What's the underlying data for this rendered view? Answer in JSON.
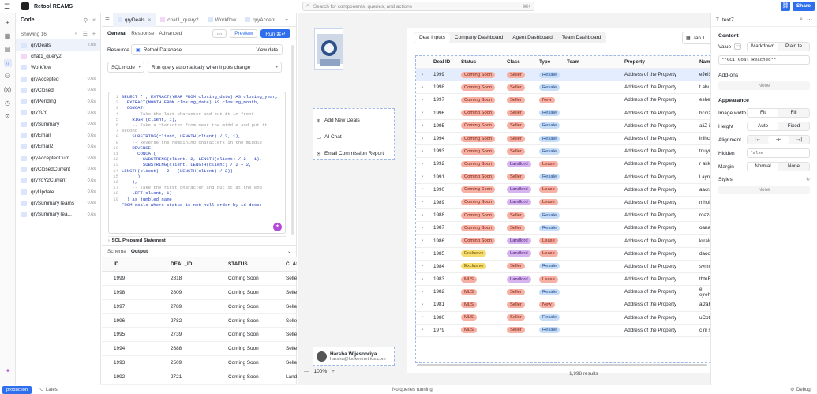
{
  "app": {
    "title": "Retool REAMS",
    "search_placeholder": "Search for components, queries, and actions",
    "search_shortcut": "⌘K",
    "share_label": "Share"
  },
  "code_panel": {
    "title": "Code",
    "showing": "Showing 16",
    "items": [
      {
        "name": "qryDeals",
        "time": "2.0s",
        "selected": true
      },
      {
        "name": "chat1_query2",
        "time": ""
      },
      {
        "name": "Workflow",
        "time": ""
      },
      {
        "name": "qryAccepted",
        "time": "0.6s"
      },
      {
        "name": "qryClosed",
        "time": "0.6s"
      },
      {
        "name": "qryPending",
        "time": "0.6s"
      },
      {
        "name": "qryYoY",
        "time": "0.6s"
      },
      {
        "name": "qrySummary",
        "time": "0.6s"
      },
      {
        "name": "qryEmail",
        "time": "0.6s"
      },
      {
        "name": "qryEmail2",
        "time": "0.6s"
      },
      {
        "name": "qryAcceptedCurr...",
        "time": "0.6s"
      },
      {
        "name": "qryClosedCurrent",
        "time": "0.6s"
      },
      {
        "name": "qryYoY2Current",
        "time": "0.6s"
      },
      {
        "name": "qryUpdate",
        "time": "0.6s"
      },
      {
        "name": "qrySummaryTeams",
        "time": "0.6s"
      },
      {
        "name": "qrySummaryTea...",
        "time": "0.6s"
      }
    ]
  },
  "editor": {
    "tabs": [
      "qryDeals",
      "chat1_query2",
      "Workflow",
      "qryAccept"
    ],
    "subtabs": [
      "General",
      "Response",
      "Advanced"
    ],
    "preview": "Preview",
    "run": "Run ⌘↵",
    "resource_label": "Resource",
    "resource_value": "Retool Database",
    "view_data": "View data",
    "mode": "SQL mode",
    "trigger": "Run query automatically when inputs change",
    "code_lines": [
      "SELECT * , EXTRACT(YEAR FROM closing_date) AS closing_year,",
      "  EXTRACT(MONTH FROM closing_date) AS closing_month,",
      "  CONCAT(",
      "    -- Take the last character and put it in front",
      "    RIGHT(client, 1),",
      "    -- Take a character from near the middle and put it",
      "second",
      "    SUBSTRING(client, LENGTH(client) / 2, 1),",
      "    -- Reverse the remaining characters in the middle",
      "    REVERSE(",
      "      CONCAT(",
      "        SUBSTRING(client, 2, LENGTH(client) / 2 - 1),",
      "        SUBSTRING(client, LENGTH(client) / 2 + 2,",
      "LENGTH(client) - 2 - (LENGTH(client) / 2))",
      "      )",
      "    ),",
      "    -- Take the first character and put it at the end",
      "    LEFT(client, 1)",
      "  ) as jumbled_name",
      "FROM deals where status is not null order by id desc;"
    ],
    "line_numbers": [
      "1",
      "2",
      "3",
      "4",
      "5",
      "6",
      "",
      "7",
      "8",
      "9",
      "10",
      "11",
      "12",
      "13",
      "14",
      "15",
      "16",
      "17",
      "18",
      "19"
    ],
    "prepared": "SQL Prepared Statement",
    "output_tabs": [
      "Schema",
      "Output"
    ],
    "output_columns": [
      "ID",
      "DEAL_ID",
      "STATUS",
      "CLAS"
    ],
    "output_rows": [
      [
        "1999",
        "2818",
        "Coming Soon",
        "Seller"
      ],
      [
        "1998",
        "2809",
        "Coming Soon",
        "Seller"
      ],
      [
        "1997",
        "2789",
        "Coming Soon",
        "Seller"
      ],
      [
        "1996",
        "2782",
        "Coming Soon",
        "Seller"
      ],
      [
        "1995",
        "2739",
        "Coming Soon",
        "Seller"
      ],
      [
        "1994",
        "2688",
        "Coming Soon",
        "Seller"
      ],
      [
        "1993",
        "2509",
        "Coming Soon",
        "Seller"
      ],
      [
        "1992",
        "2721",
        "Coming Soon",
        "Landl"
      ]
    ]
  },
  "canvas": {
    "nav": [
      "Add New Deals",
      "AI Chat",
      "Email Commission Report"
    ],
    "user_name": "Harsha Wijesooriya",
    "user_email": "harsha@lookermetrics.com",
    "tabs": [
      "Deal Inputs",
      "Company Dashboard",
      "Agent Dashboard",
      "Team Dashboard"
    ],
    "date_label": "Jan 1",
    "columns": [
      "Deal ID",
      "Status",
      "Class",
      "Type",
      "Team",
      "Property",
      "Name"
    ],
    "rows": [
      {
        "id": "1999",
        "status": "Coming Soon",
        "class": "Seller",
        "type": "Resale",
        "prop": "Address of the Property",
        "name": "eJelS"
      },
      {
        "id": "1998",
        "status": "Coming Soon",
        "class": "Seller",
        "type": "Resale",
        "prop": "Address of the Property",
        "name": "t abuK"
      },
      {
        "id": "1997",
        "status": "Coming Soon",
        "class": "Seller",
        "type": "New",
        "prop": "Address of the Property",
        "name": "esheiP"
      },
      {
        "id": "1996",
        "status": "Coming Soon",
        "class": "Seller",
        "type": "Resale",
        "prop": "Address of the Property",
        "name": "hcinzt"
      },
      {
        "id": "1995",
        "status": "Coming Soon",
        "class": "Seller",
        "type": "Resale",
        "prop": "Address of the Property",
        "name": "aiiZ im"
      },
      {
        "id": "1994",
        "status": "Coming Soon",
        "class": "Seller",
        "type": "Resale",
        "prop": "Address of the Property",
        "name": "irlihcna"
      },
      {
        "id": "1993",
        "status": "Coming Soon",
        "class": "Seller",
        "type": "Resale",
        "prop": "Address of the Property",
        "name": "tnuyu"
      },
      {
        "id": "1992",
        "status": "Coming Soon",
        "class": "Landlord",
        "type": "Lease",
        "prop": "Address of the Property",
        "name": "r akka"
      },
      {
        "id": "1991",
        "status": "Coming Soon",
        "class": "Seller",
        "type": "Resale",
        "prop": "Address of the Property",
        "name": "l ayna"
      },
      {
        "id": "1990",
        "status": "Coming Soon",
        "class": "Landlord",
        "type": "Lease",
        "prop": "Address of the Property",
        "name": "aacran"
      },
      {
        "id": "1989",
        "status": "Coming Soon",
        "class": "Landlord",
        "type": "Lease",
        "prop": "Address of the Property",
        "name": "mhoiB"
      },
      {
        "id": "1988",
        "status": "Coming Soon",
        "class": "Seller",
        "type": "Resale",
        "prop": "Address of the Property",
        "name": "roazal"
      },
      {
        "id": "1987",
        "status": "Coming Soon",
        "class": "Seller",
        "type": "Resale",
        "prop": "Address of the Property",
        "name": "oanac"
      },
      {
        "id": "1986",
        "status": "Coming Soon",
        "class": "Landlord",
        "type": "Lease",
        "prop": "Address of the Property",
        "name": "krralC"
      },
      {
        "id": "1985",
        "status": "Exclusive",
        "class": "Landlord",
        "type": "Lease",
        "prop": "Address of the Property",
        "name": "daooG"
      },
      {
        "id": "1984",
        "status": "Exclusive",
        "class": "Seller",
        "type": "Resale",
        "prop": "Address of the Property",
        "name": "svmmi"
      },
      {
        "id": "1983",
        "status": "MLS",
        "class": "Landlord",
        "type": "Lease",
        "prop": "Address of the Property",
        "name": "tbtuB"
      },
      {
        "id": "1982",
        "status": "MLS",
        "class": "Seller",
        "type": "Resale",
        "prop": "Address of the Property",
        "name": "e ejreh"
      },
      {
        "id": "1981",
        "status": "MLS",
        "class": "Seller",
        "type": "New",
        "prop": "Address of the Property",
        "name": "aizaR"
      },
      {
        "id": "1980",
        "status": "MLS",
        "class": "Seller",
        "type": "Resale",
        "prop": "Address of the Property",
        "name": "uCotsi"
      },
      {
        "id": "1979",
        "status": "MLS",
        "class": "Seller",
        "type": "Resale",
        "prop": "Address of the Property",
        "name": "c nl sc"
      }
    ],
    "results": "1,998 results",
    "zoom": "100%"
  },
  "props": {
    "component": "text7",
    "content": "Content",
    "value_label": "Value",
    "formats": [
      "Markdown",
      "Plain te"
    ],
    "value": "**GCI Goal Reached**",
    "addons": "Add-ons",
    "none": "None",
    "appearance": "Appearance",
    "image_width": "Image width",
    "iw_opts": [
      "Fit",
      "Fill"
    ],
    "height": "Height",
    "h_opts": [
      "Auto",
      "Fixed"
    ],
    "alignment": "Alignment",
    "hidden": "Hidden",
    "hidden_val": "false",
    "margin": "Margin",
    "m_opts": [
      "Normal",
      "None"
    ],
    "styles": "Styles"
  },
  "status": {
    "env": "production",
    "latest": "Latest",
    "running": "No queries running",
    "debug": "Debug"
  },
  "colors": {
    "accent": "#2f6fed",
    "run": "#2f6fed"
  }
}
